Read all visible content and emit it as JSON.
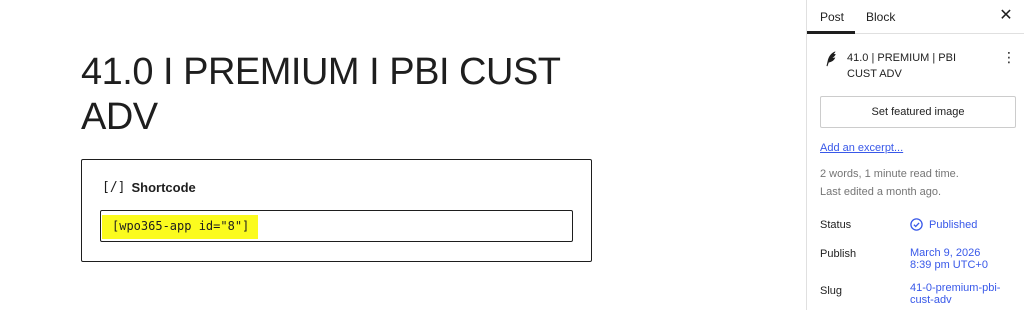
{
  "editor": {
    "title_line1": "41.0 I PREMIUM I PBI CUST",
    "title_line2": "ADV",
    "shortcode_block": {
      "icon": "[/]",
      "label": "Shortcode",
      "value": "[wpo365-app id=\"8\"]",
      "highlight_color": "#fbfb1e"
    }
  },
  "sidebar": {
    "tabs": [
      {
        "label": "Post",
        "active": true
      },
      {
        "label": "Block",
        "active": false
      }
    ],
    "close_icon": "close-icon",
    "post_icon": "feather-icon",
    "post_title": "41.0 | PREMIUM | PBI CUST ADV",
    "more_icon": "more-vertical-icon",
    "featured_image_button": "Set featured image",
    "excerpt_link": "Add an excerpt...",
    "word_count": "2 words, 1 minute read time.",
    "last_edited": "Last edited a month ago.",
    "status": {
      "label": "Status",
      "value": "Published",
      "icon": "check-circle-icon"
    },
    "publish": {
      "label": "Publish",
      "value_line1": "March 9, 2026",
      "value_line2": "8:39 pm UTC+0"
    },
    "slug": {
      "label": "Slug",
      "value_line1": "41-0-premium-pbi-",
      "value_line2": "cust-adv"
    },
    "accent_color": "#3858e9"
  }
}
